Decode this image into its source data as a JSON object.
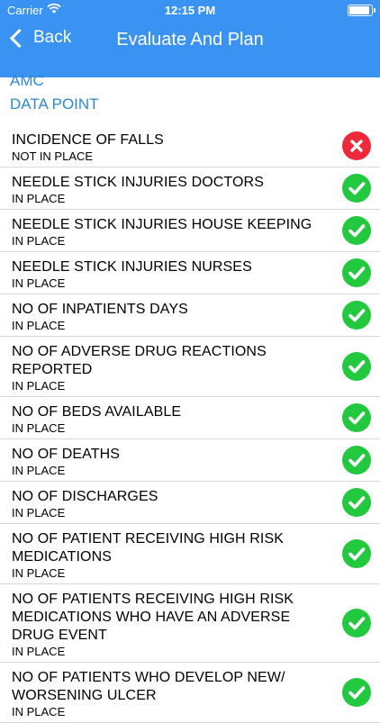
{
  "status_bar": {
    "carrier": "Carrier",
    "time": "12:15 PM"
  },
  "nav": {
    "back_label": "Back",
    "title": "Evaluate And Plan"
  },
  "section": {
    "org": "AMC",
    "category": "DATA POINT"
  },
  "colors": {
    "header": "#3a93f3",
    "link": "#2a8ad6",
    "ok": "#22c93e",
    "bad": "#f0283c"
  },
  "rows": [
    {
      "name": "INCIDENCE OF FALLS",
      "status": "NOT IN PLACE",
      "icon": "cross-icon"
    },
    {
      "name": "NEEDLE STICK INJURIES DOCTORS",
      "status": "IN PLACE",
      "icon": "check-icon"
    },
    {
      "name": "NEEDLE STICK INJURIES HOUSE KEEPING",
      "status": "IN PLACE",
      "icon": "check-icon"
    },
    {
      "name": "NEEDLE STICK INJURIES NURSES",
      "status": "IN PLACE",
      "icon": "check-icon"
    },
    {
      "name": "NO OF  INPATIENTS DAYS",
      "status": "IN PLACE",
      "icon": "check-icon"
    },
    {
      "name": "NO OF ADVERSE DRUG REACTIONS REPORTED",
      "status": "IN PLACE",
      "icon": "check-icon"
    },
    {
      "name": "NO OF BEDS AVAILABLE",
      "status": "IN PLACE",
      "icon": "check-icon"
    },
    {
      "name": "NO OF DEATHS",
      "status": "IN PLACE",
      "icon": "check-icon"
    },
    {
      "name": "NO OF DISCHARGES",
      "status": "IN PLACE",
      "icon": "check-icon"
    },
    {
      "name": "NO OF PATIENT RECEIVING HIGH RISK MEDICATIONS",
      "status": "IN PLACE",
      "icon": "check-icon"
    },
    {
      "name": "NO OF PATIENTS RECEIVING HIGH RISK MEDICATIONS WHO HAVE AN ADVERSE DRUG EVENT",
      "status": "IN PLACE",
      "icon": "check-icon"
    },
    {
      "name": "NO OF PATIENTS WHO DEVELOP NEW/ WORSENING ULCER",
      "status": "IN PLACE",
      "icon": "check-icon"
    }
  ]
}
